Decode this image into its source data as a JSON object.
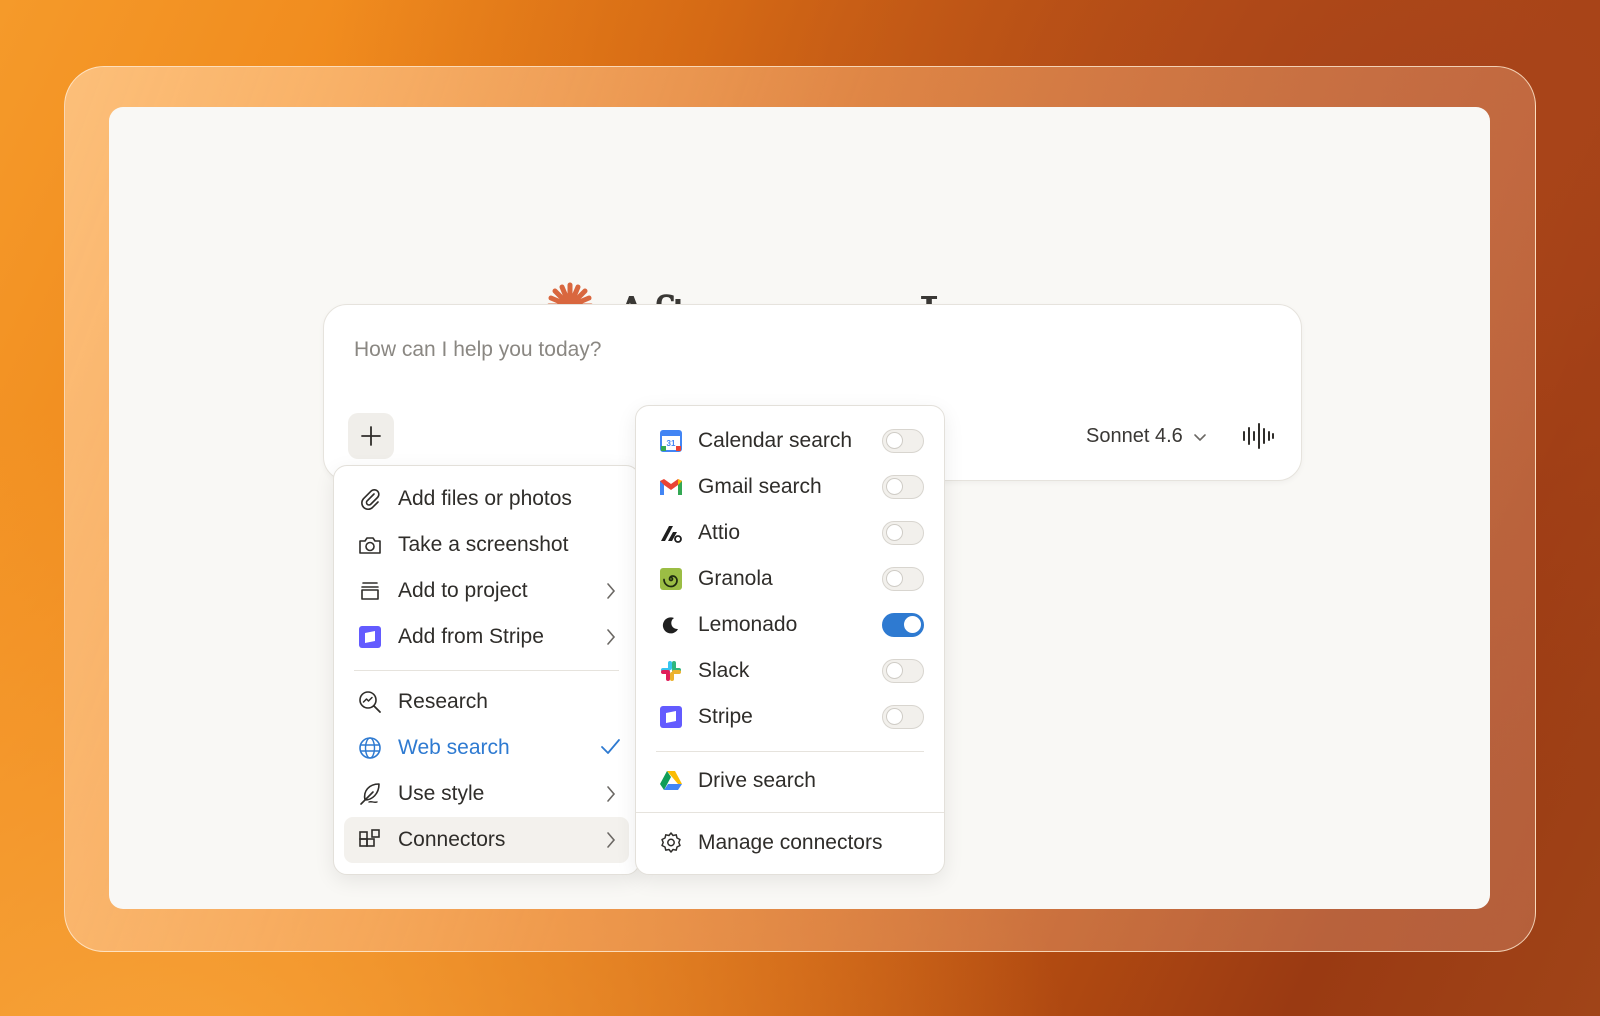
{
  "greeting": {
    "text": "Afternoon, Lane"
  },
  "composer": {
    "placeholder": "How can I help you today?",
    "model_label": "Sonnet 4.6"
  },
  "add_menu": {
    "items": [
      {
        "label": "Add files or photos",
        "icon": "paperclip-icon"
      },
      {
        "label": "Take a screenshot",
        "icon": "camera-icon"
      },
      {
        "label": "Add to project",
        "icon": "project-icon",
        "has_submenu": true
      },
      {
        "label": "Add from Stripe",
        "icon": "stripe-icon",
        "has_submenu": true
      },
      {
        "label": "Research",
        "icon": "research-icon"
      },
      {
        "label": "Web search",
        "icon": "globe-icon",
        "checked": true
      },
      {
        "label": "Use style",
        "icon": "feather-icon",
        "has_submenu": true
      },
      {
        "label": "Connectors",
        "icon": "connectors-icon",
        "has_submenu": true,
        "active": true
      }
    ]
  },
  "connectors_menu": {
    "items": [
      {
        "label": "Calendar search",
        "icon": "google-calendar-icon",
        "enabled": false
      },
      {
        "label": "Gmail search",
        "icon": "gmail-icon",
        "enabled": false
      },
      {
        "label": "Attio",
        "icon": "attio-icon",
        "enabled": false
      },
      {
        "label": "Granola",
        "icon": "granola-icon",
        "enabled": false
      },
      {
        "label": "Lemonado",
        "icon": "lemonado-icon",
        "enabled": true
      },
      {
        "label": "Slack",
        "icon": "slack-icon",
        "enabled": false
      },
      {
        "label": "Stripe",
        "icon": "stripe-icon",
        "enabled": false
      }
    ],
    "drive": {
      "label": "Drive search",
      "icon": "google-drive-icon"
    },
    "manage": {
      "label": "Manage connectors",
      "icon": "gear-icon"
    }
  },
  "colors": {
    "accent_orange": "#d9673f",
    "toggle_on": "#2e7ad1",
    "web_search_blue": "#2e7ad1",
    "stripe_purple": "#635bff"
  }
}
